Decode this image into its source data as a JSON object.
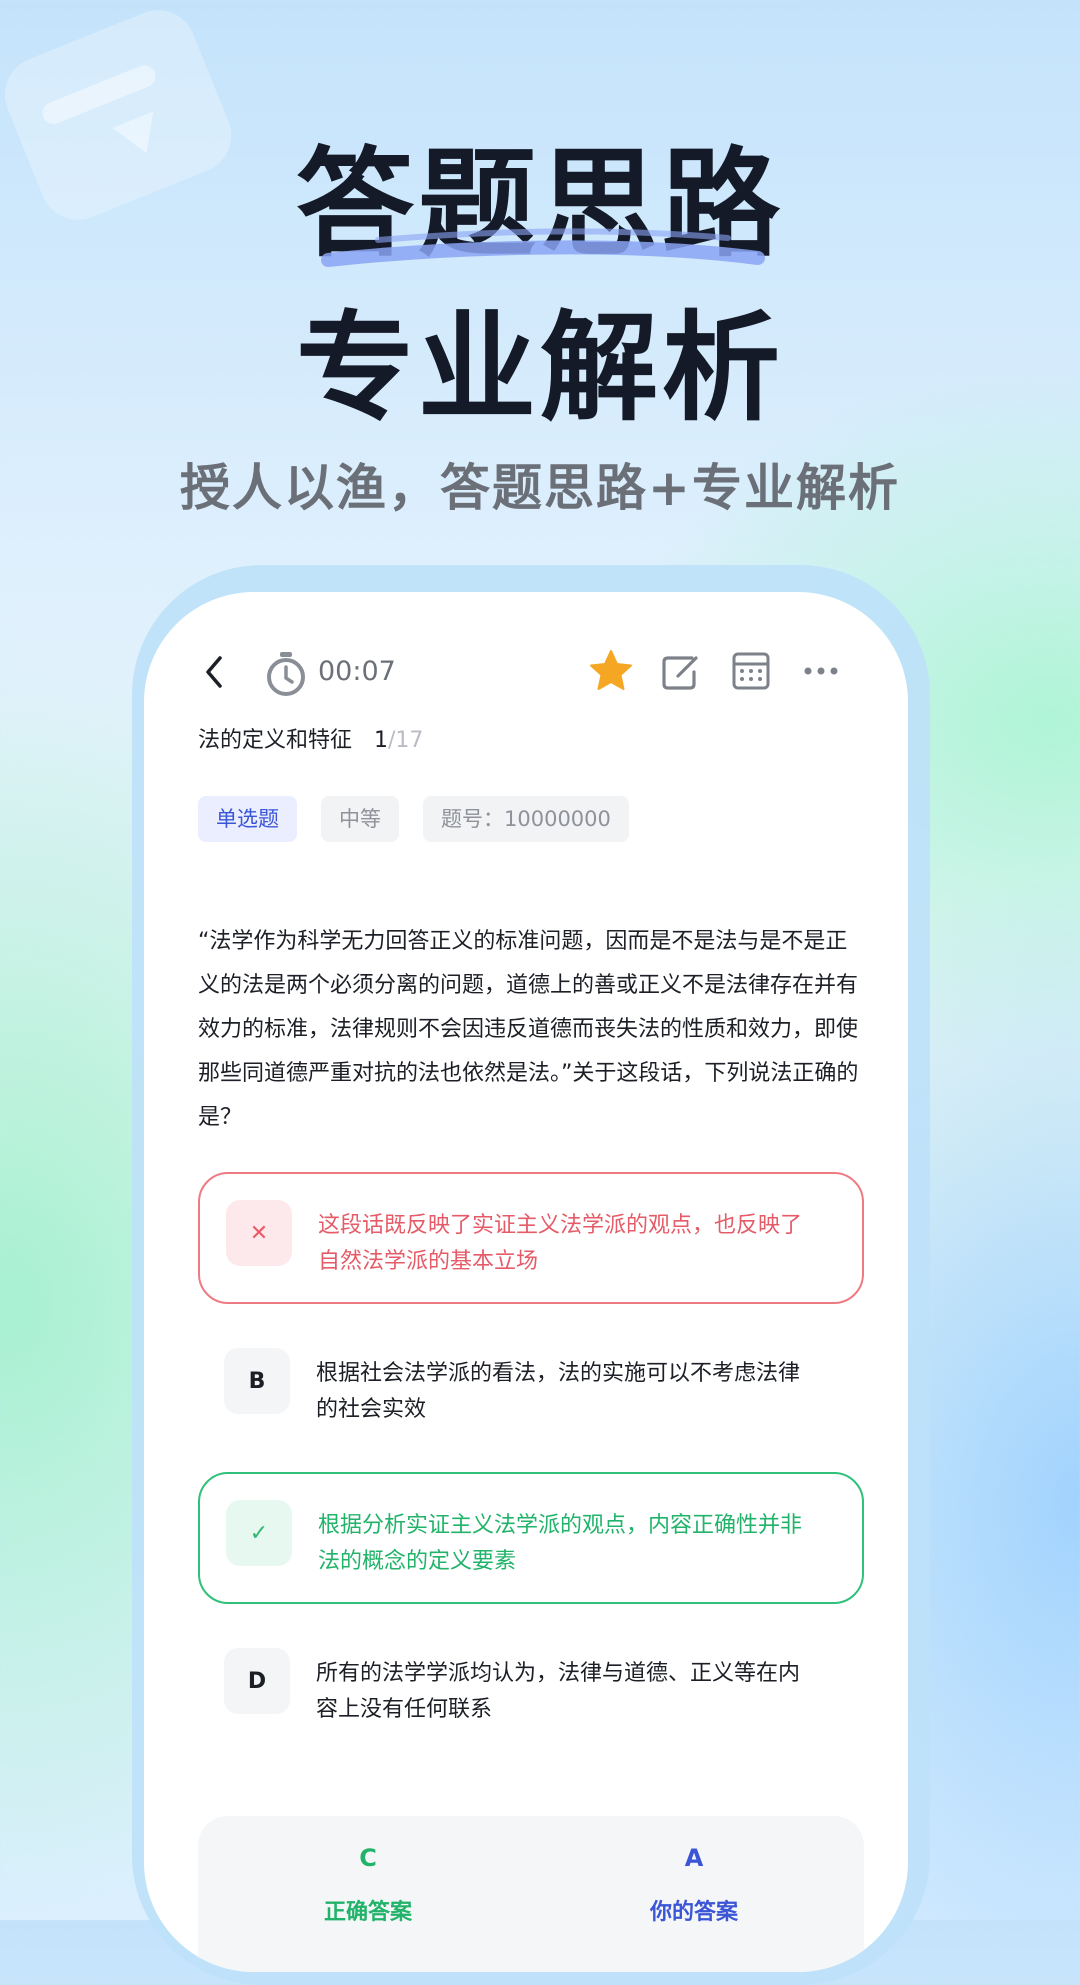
{
  "promo": {
    "headline_line1": "答题思路",
    "headline_line2": "专业解析",
    "subtitle": "授人以渔，答题思路+专业解析",
    "accent_color": "#8aa4f5"
  },
  "topbar": {
    "back_icon": "chevron-left-icon",
    "timer_icon": "stopwatch-icon",
    "timer": "00:07",
    "favorite_icon": "star-icon",
    "favorite_color": "#f5a623",
    "edit_icon": "edit-note-icon",
    "calculator_icon": "calculator-icon",
    "more_icon": "more-dots-icon"
  },
  "section": {
    "title": "法的定义和特征",
    "current": "1",
    "total": "/17"
  },
  "tags": {
    "type": "单选题",
    "difficulty": "中等",
    "question_no": "题号：10000000"
  },
  "question": {
    "text": "“法学作为科学无力回答正义的标准问题，因而是不是法与是不是正义的法是两个必须分离的问题，道德上的善或正义不是法律存在并有效力的标准，法律规则不会因违反道德而丧失法的性质和效力，即使那些同道德严重对抗的法也依然是法。”关于这段话，下列说法正确的是？"
  },
  "options": [
    {
      "key": "A",
      "badge": "✕",
      "state": "wrong",
      "text": "这段话既反映了实证主义法学派的观点，也反映了自然法学派的基本立场"
    },
    {
      "key": "B",
      "badge": "B",
      "state": "normal",
      "text": "根据社会法学派的看法，法的实施可以不考虑法律的社会实效"
    },
    {
      "key": "C",
      "badge": "✓",
      "state": "correct",
      "text": "根据分析实证主义法学派的观点，内容正确性并非法的概念的定义要素"
    },
    {
      "key": "D",
      "badge": "D",
      "state": "normal",
      "text": "所有的法学学派均认为，法律与道德、正义等在内容上没有任何联系"
    }
  ],
  "answers": {
    "correct_letter": "C",
    "correct_label": "正确答案",
    "yours_letter": "A",
    "yours_label": "你的答案",
    "correct_color": "#22b36a",
    "wrong_color": "#ea5a67",
    "yours_color": "#3a55d6"
  }
}
